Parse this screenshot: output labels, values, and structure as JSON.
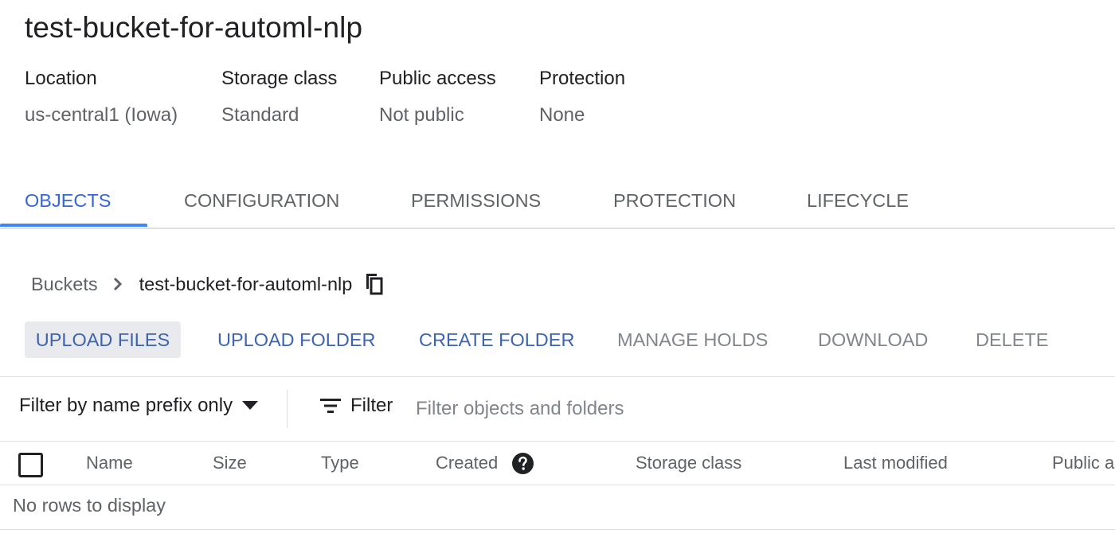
{
  "bucket": {
    "title": "test-bucket-for-automl-nlp"
  },
  "meta": [
    {
      "label": "Location",
      "value": "us-central1 (Iowa)"
    },
    {
      "label": "Storage class",
      "value": "Standard"
    },
    {
      "label": "Public access",
      "value": "Not public"
    },
    {
      "label": "Protection",
      "value": "None"
    }
  ],
  "tabs": [
    {
      "label": "OBJECTS",
      "active": true
    },
    {
      "label": "CONFIGURATION",
      "active": false
    },
    {
      "label": "PERMISSIONS",
      "active": false
    },
    {
      "label": "PROTECTION",
      "active": false
    },
    {
      "label": "LIFECYCLE",
      "active": false
    }
  ],
  "breadcrumb": {
    "root": "Buckets",
    "current": "test-bucket-for-automl-nlp",
    "separator_icon": "chevron-right-icon",
    "copy_icon": "copy-icon"
  },
  "actions": [
    {
      "label": "UPLOAD FILES",
      "state": "primary-selected"
    },
    {
      "label": "UPLOAD FOLDER",
      "state": "primary"
    },
    {
      "label": "CREATE FOLDER",
      "state": "primary"
    },
    {
      "label": "MANAGE HOLDS",
      "state": "disabled"
    },
    {
      "label": "DOWNLOAD",
      "state": "disabled"
    },
    {
      "label": "DELETE",
      "state": "disabled"
    }
  ],
  "filter": {
    "mode_label": "Filter by name prefix only",
    "button_label": "Filter",
    "placeholder": "Filter objects and folders",
    "value": ""
  },
  "table": {
    "columns": [
      "Name",
      "Size",
      "Type",
      "Created",
      "Storage class",
      "Last modified",
      "Public a"
    ],
    "empty_message": "No rows to display"
  },
  "colors": {
    "accent": "#4285f4",
    "primary_action": "#3c64b1",
    "disabled_action": "#80868b"
  }
}
